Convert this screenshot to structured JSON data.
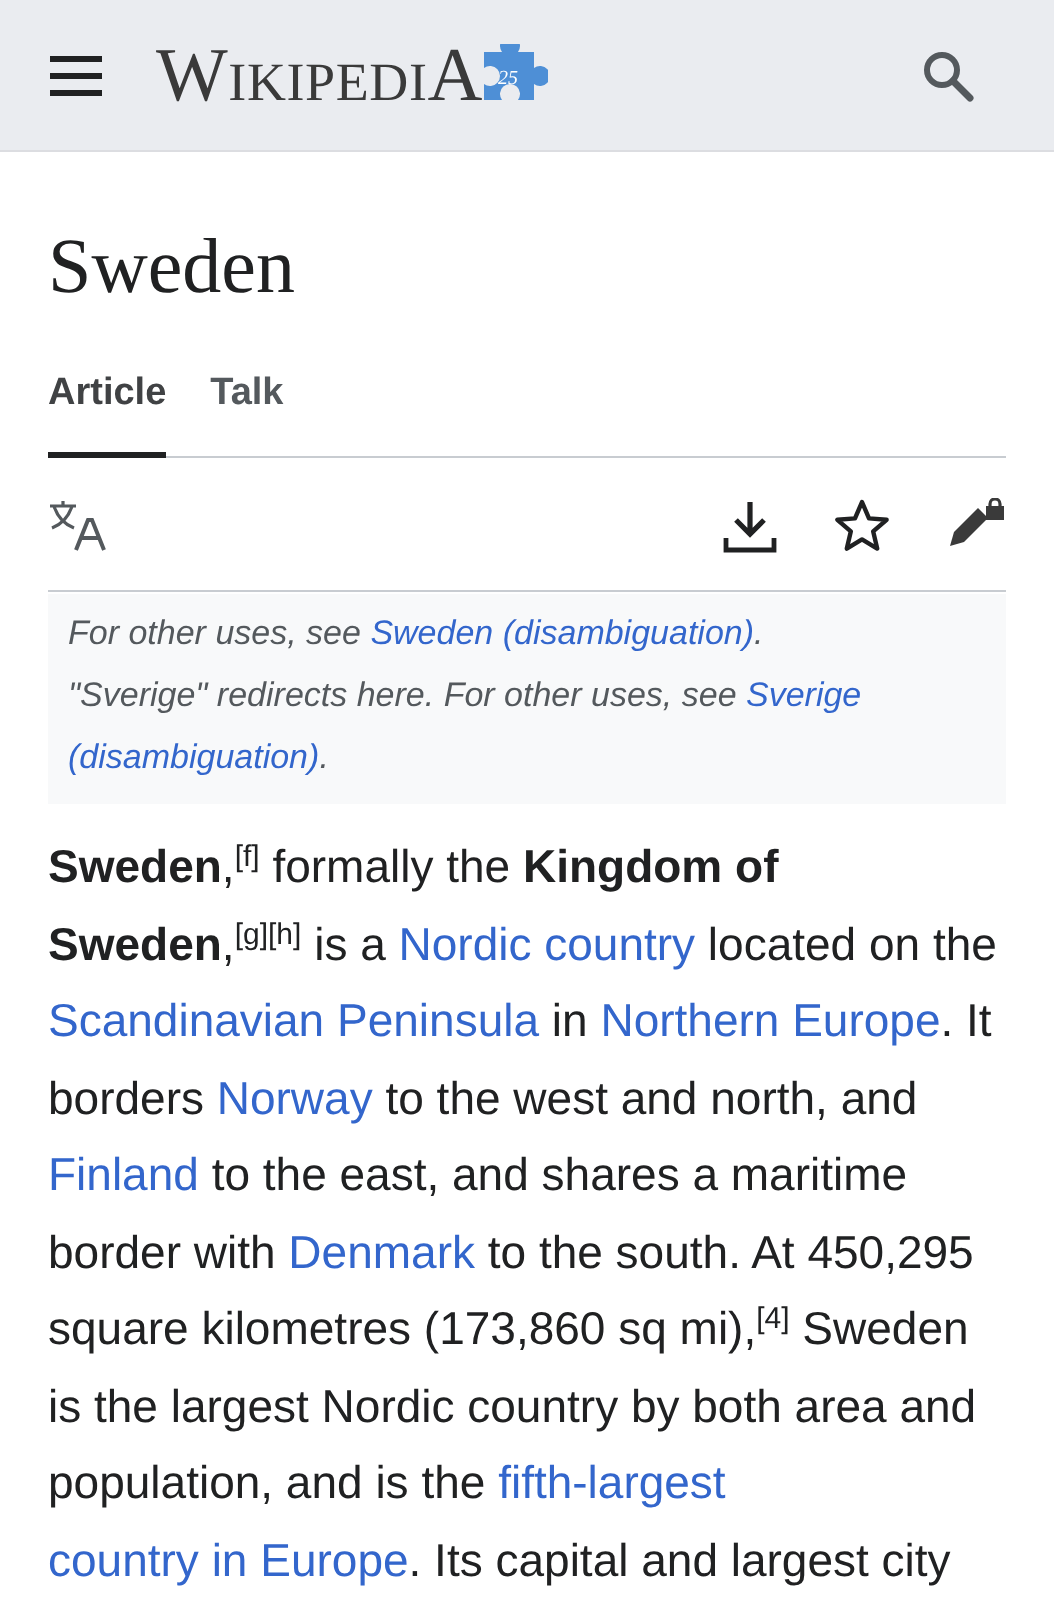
{
  "header": {
    "logo": "WikipediA",
    "badge": "25"
  },
  "title": "Sweden",
  "tabs": [
    {
      "label": "Article",
      "selected": true
    },
    {
      "label": "Talk",
      "selected": false
    }
  ],
  "hatnotes": [
    [
      {
        "kind": "text",
        "text": "For other uses, see "
      },
      {
        "kind": "link",
        "text": "Sweden (disambiguation)"
      },
      {
        "kind": "text",
        "text": "."
      }
    ],
    [
      {
        "kind": "text",
        "text": "\"Sverige\" redirects here. For other uses, see "
      },
      {
        "kind": "link",
        "text": "Sverige"
      },
      {
        "kind": "space"
      },
      {
        "kind": "link",
        "text": "(disambiguation)"
      },
      {
        "kind": "text",
        "text": "."
      }
    ]
  ],
  "paragraph": [
    {
      "kind": "bold",
      "text": "Sweden"
    },
    {
      "kind": "text",
      "text": ",",
      "refs": [
        "[f]"
      ]
    },
    {
      "kind": "text",
      "text": " formally the "
    },
    {
      "kind": "bold",
      "text": "Kingdom of Sweden"
    },
    {
      "kind": "text",
      "text": ",",
      "refs": [
        "[g]",
        "[h]"
      ]
    },
    {
      "kind": "text",
      "text": " is a "
    },
    {
      "kind": "link",
      "text": "Nordic country"
    },
    {
      "kind": "text",
      "text": " located on the "
    },
    {
      "kind": "link",
      "text": "Scandinavian Peninsula"
    },
    {
      "kind": "text",
      "text": " in "
    },
    {
      "kind": "link",
      "text": "Northern"
    },
    {
      "kind": "space"
    },
    {
      "kind": "link",
      "text": "Europe"
    },
    {
      "kind": "text",
      "text": ". It borders "
    },
    {
      "kind": "link",
      "text": "Norway"
    },
    {
      "kind": "text",
      "text": " to the west and north, and "
    },
    {
      "kind": "link",
      "text": "Finland"
    },
    {
      "kind": "text",
      "text": " to the east, and shares a maritime border with "
    },
    {
      "kind": "link",
      "text": "Denmark"
    },
    {
      "kind": "text",
      "text": " to the south. At 450,295 square kilometres (173,860 sq mi)"
    },
    {
      "kind": "text",
      "text": ",",
      "refs": [
        "[4]"
      ]
    },
    {
      "kind": "text",
      "text": " Sweden is the largest Nordic country by both area and population, and is the "
    },
    {
      "kind": "link",
      "text": "fifth-largest"
    },
    {
      "kind": "space"
    },
    {
      "kind": "link",
      "text": "country in Europe"
    },
    {
      "kind": "text",
      "text": ". Its capital and largest city"
    }
  ]
}
